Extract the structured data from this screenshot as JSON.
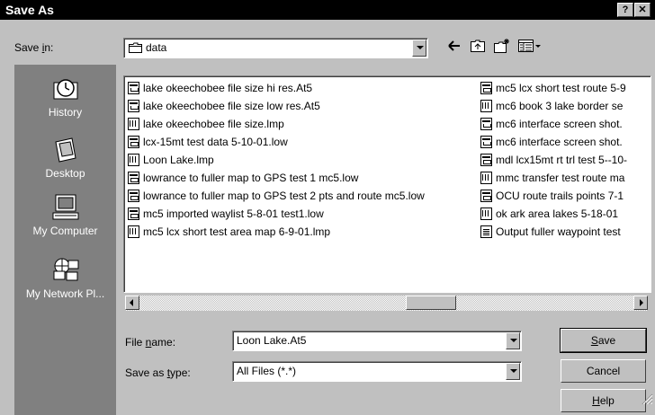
{
  "window": {
    "title": "Save As",
    "help_label": "?",
    "close_label": "✕"
  },
  "save_in": {
    "label_pre": "Save ",
    "label_key": "i",
    "label_post": "n:",
    "value": "data",
    "folder_icon": "folder-icon"
  },
  "toolbar": {
    "back_icon": "back-arrow-icon",
    "up_icon": "up-folder-icon",
    "new_folder_icon": "new-folder-icon",
    "views_icon": "views-menu-icon"
  },
  "places": [
    {
      "label": "History",
      "icon": "history-icon"
    },
    {
      "label": "Desktop",
      "icon": "desktop-icon"
    },
    {
      "label": "My Computer",
      "icon": "my-computer-icon"
    },
    {
      "label": "My Network Pl...",
      "icon": "my-network-places-icon"
    }
  ],
  "files_col1": [
    {
      "name": "lake okeechobee file size hi res.At5",
      "kind": "at5"
    },
    {
      "name": "lake okeechobee file size low res.At5",
      "kind": "at5"
    },
    {
      "name": "lake okeechobee file size.lmp",
      "kind": "lmp"
    },
    {
      "name": "lcx-15mt test data 5-10-01.low",
      "kind": "low"
    },
    {
      "name": "Loon Lake.lmp",
      "kind": "lmp"
    },
    {
      "name": "lowrance to fuller map to GPS test 1 mc5.low",
      "kind": "low"
    },
    {
      "name": "lowrance to fuller map to GPS test 2 pts and route mc5.low",
      "kind": "low"
    },
    {
      "name": "mc5 imported waylist 5-8-01 test1.low",
      "kind": "low"
    },
    {
      "name": "mc5 lcx short test area map 6-9-01.lmp",
      "kind": "lmp"
    }
  ],
  "files_col2": [
    {
      "name": "mc5 lcx short test route 5-9",
      "kind": "low"
    },
    {
      "name": "mc6 book 3 lake border se",
      "kind": "lmp"
    },
    {
      "name": "mc6 interface screen shot.",
      "kind": "at5"
    },
    {
      "name": "mc6 interface screen shot.",
      "kind": "at5"
    },
    {
      "name": "mdl lcx15mt rt trl test 5--10-",
      "kind": "low"
    },
    {
      "name": "mmc transfer test route ma",
      "kind": "lmp"
    },
    {
      "name": "OCU route trails points 7-1",
      "kind": "low"
    },
    {
      "name": "ok ark area lakes 5-18-01",
      "kind": "lmp"
    },
    {
      "name": "Output fuller waypoint test",
      "kind": "txt"
    }
  ],
  "file_name": {
    "label_pre": "File ",
    "label_key": "n",
    "label_post": "ame:",
    "value": "Loon Lake.At5"
  },
  "save_type": {
    "label_pre": "Save as ",
    "label_key": "t",
    "label_post": "ype:",
    "value": "All Files (*.*)"
  },
  "buttons": {
    "save_key": "S",
    "save_rest": "ave",
    "cancel": "Cancel",
    "help_key": "H",
    "help_rest": "elp"
  }
}
